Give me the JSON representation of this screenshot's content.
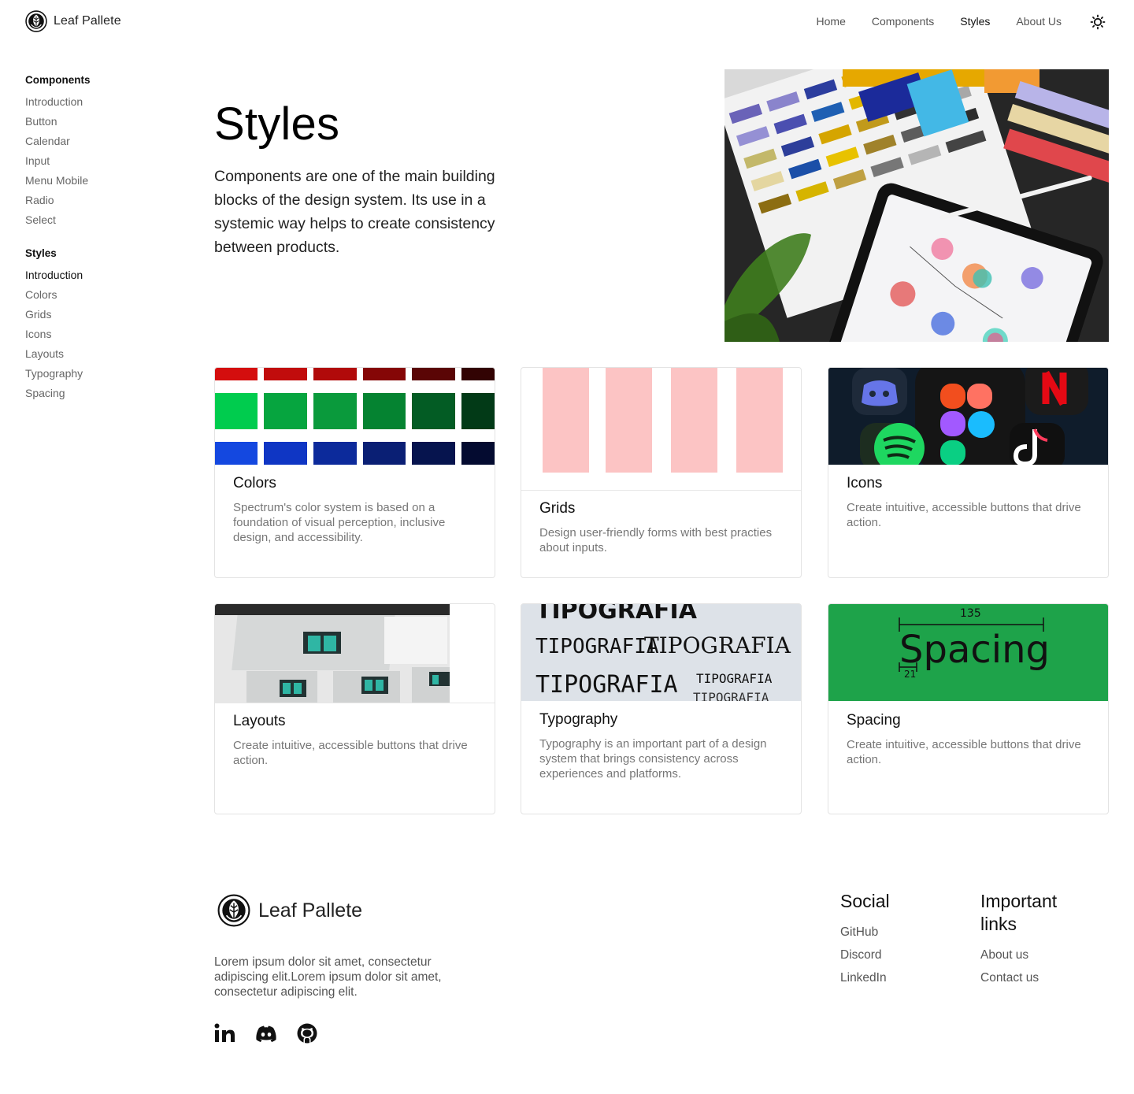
{
  "header": {
    "brand": "Leaf Pallete",
    "nav": [
      {
        "label": "Home",
        "active": false
      },
      {
        "label": "Components",
        "active": false
      },
      {
        "label": "Styles",
        "active": true
      },
      {
        "label": "About Us",
        "active": false
      }
    ]
  },
  "sidebar": {
    "groups": [
      {
        "title": "Components",
        "items": [
          "Introduction",
          "Button",
          "Calendar",
          "Input",
          "Menu Mobile",
          "Radio",
          "Select"
        ]
      },
      {
        "title": "Styles",
        "items": [
          "Introduction",
          "Colors",
          "Grids",
          "Icons",
          "Layouts",
          "Typography",
          "Spacing"
        ],
        "active_index": 0
      }
    ]
  },
  "hero": {
    "title": "Styles",
    "text": "Components are one of the main building blocks of the design system. Its use in a systemic way helps to create consistency between products."
  },
  "cards": [
    {
      "title": "Colors",
      "desc": "Spectrum's color system is based on a foundation of visual perception, inclusive design, and accessibility."
    },
    {
      "title": "Grids",
      "desc": "Design user-friendly forms with best practies about inputs."
    },
    {
      "title": "Icons",
      "desc": "Create intuitive, accessible buttons that drive action."
    },
    {
      "title": "Layouts",
      "desc": "Create intuitive, accessible buttons that drive action."
    },
    {
      "title": "Typography",
      "desc": "Typography is an important part of a design system that brings consistency across experiences and platforms."
    },
    {
      "title": "Spacing",
      "desc": "Create intuitive, accessible buttons that drive action."
    }
  ],
  "media": {
    "typography_words": [
      "TIPOGRAFIA",
      "TIPOGRAFIA",
      "TIPOGRAFIA",
      "TIPOGRAFIA",
      "TIPOGRAFIA",
      "TIPOGRAFIA"
    ],
    "spacing_word": "Spacing",
    "spacing_top": "135",
    "spacing_side": "21"
  },
  "colors": {
    "grid_pink": "#fcc4c4",
    "spacing_green": "#1ea34a",
    "reds": [
      "#d40e0e",
      "#c10c0c",
      "#b10a0a",
      "#850606",
      "#5a0505",
      "#320303"
    ],
    "greens": [
      "#00cc4e",
      "#06a53f",
      "#0a9a3c",
      "#058331",
      "#035c24",
      "#023a17"
    ],
    "blues": [
      "#1448e0",
      "#0f36c4",
      "#0c2a9b",
      "#0a1f74",
      "#06144e",
      "#040b30"
    ]
  },
  "footer": {
    "brand": "Leaf Pallete",
    "text": "Lorem ipsum dolor sit amet, consectetur adipiscing elit.Lorem ipsum dolor sit amet, consectetur adipiscing elit.",
    "social_title": "Social",
    "social_links": [
      "GitHub",
      "Discord",
      "LinkedIn"
    ],
    "important_title": "Important links",
    "important_links": [
      "About us",
      "Contact us"
    ]
  }
}
